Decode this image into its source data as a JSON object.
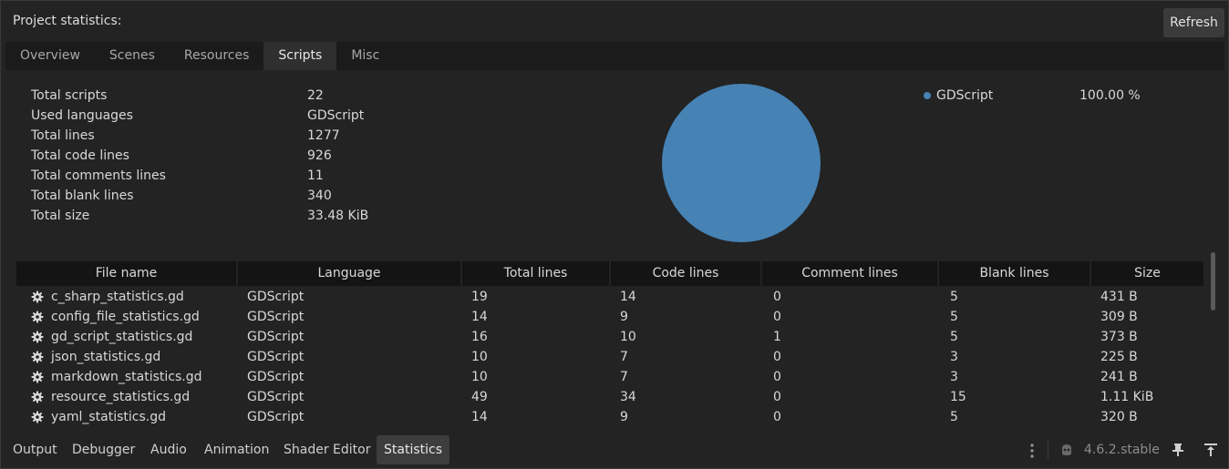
{
  "header": {
    "title": "Project statistics:",
    "refresh_label": "Refresh"
  },
  "tabs": [
    {
      "label": "Overview",
      "active": false
    },
    {
      "label": "Scenes",
      "active": false
    },
    {
      "label": "Resources",
      "active": false
    },
    {
      "label": "Scripts",
      "active": true
    },
    {
      "label": "Misc",
      "active": false
    }
  ],
  "stats": [
    {
      "label": "Total scripts",
      "value": "22"
    },
    {
      "label": "Used languages",
      "value": "GDScript"
    },
    {
      "label": "Total lines",
      "value": "1277"
    },
    {
      "label": "Total code lines",
      "value": "926"
    },
    {
      "label": "Total comments lines",
      "value": "11"
    },
    {
      "label": "Total blank lines",
      "value": "340"
    },
    {
      "label": "Total size",
      "value": "33.48 KiB"
    }
  ],
  "chart_data": {
    "type": "pie",
    "slices": [
      {
        "label": "GDScript",
        "value": 100.0,
        "color": "#4682b4"
      }
    ],
    "legend": [
      {
        "name": "GDScript",
        "percent": "100.00 %"
      }
    ],
    "legend_position": "right"
  },
  "table": {
    "columns": [
      "File name",
      "Language",
      "Total lines",
      "Code lines",
      "Comment lines",
      "Blank lines",
      "Size"
    ],
    "rows": [
      [
        "c_sharp_statistics.gd",
        "GDScript",
        "19",
        "14",
        "0",
        "5",
        "431 B"
      ],
      [
        "config_file_statistics.gd",
        "GDScript",
        "14",
        "9",
        "0",
        "5",
        "309 B"
      ],
      [
        "gd_script_statistics.gd",
        "GDScript",
        "16",
        "10",
        "1",
        "5",
        "373 B"
      ],
      [
        "json_statistics.gd",
        "GDScript",
        "10",
        "7",
        "0",
        "3",
        "225 B"
      ],
      [
        "markdown_statistics.gd",
        "GDScript",
        "10",
        "7",
        "0",
        "3",
        "241 B"
      ],
      [
        "resource_statistics.gd",
        "GDScript",
        "49",
        "34",
        "0",
        "15",
        "1.11 KiB"
      ],
      [
        "yaml_statistics.gd",
        "GDScript",
        "14",
        "9",
        "0",
        "5",
        "320 B"
      ]
    ],
    "row_icon": "gear-icon"
  },
  "bottom_tabs": [
    {
      "label": "Output",
      "active": false
    },
    {
      "label": "Debugger",
      "active": false
    },
    {
      "label": "Audio",
      "active": false
    },
    {
      "label": "Animation",
      "active": false
    },
    {
      "label": "Shader Editor",
      "active": false
    },
    {
      "label": "Statistics",
      "active": true
    }
  ],
  "status": {
    "version": "4.6.2.stable"
  },
  "colors": {
    "accent": "#4682b4",
    "background": "#232323"
  }
}
